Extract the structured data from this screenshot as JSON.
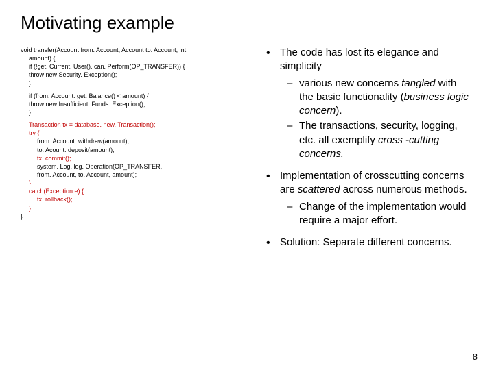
{
  "title": "Motivating example",
  "code": {
    "l1": "void transfer(Account from. Account, Account to. Account, int",
    "l2": "amount) {",
    "l3": "if (!get. Current. User(). can. Perform(OP_TRANSFER)) {",
    "l4": "throw new Security. Exception();",
    "l5": "}",
    "l6": "if (from. Account. get. Balance() < amount) {",
    "l7": "throw new Insufficient. Funds. Exception();",
    "l8": "}",
    "l9": "Transaction tx = database. new. Transaction();",
    "l10": "try {",
    "l11": "from. Account. withdraw(amount);",
    "l12": "to. Acount. deposit(amount);",
    "l13": "tx. commit();",
    "l14": "system. Log. log. Operation(OP_TRANSFER,",
    "l15": "from. Account, to. Account, amount);",
    "l16": "}",
    "l17": "catch(Exception e) {",
    "l18": "tx. rollback();",
    "l19": "}",
    "l20": "}"
  },
  "bullets": {
    "b1": "The code has lost its elegance and simplicity",
    "b1s1a": "various new concerns ",
    "b1s1b": "tangled",
    "b1s1c": " with the basic functionality (",
    "b1s1d": "business logic concern",
    "b1s1e": ").",
    "b1s2a": "The transactions, security, logging, etc. all exemplify ",
    "b1s2b": "cross -cutting concerns.",
    "b2a": "Implementation of crosscutting concerns are ",
    "b2b": "scattered",
    "b2c": " across numerous methods.",
    "b2s1": "Change of the implementation would require a major effort.",
    "b3": "Solution: Separate different concerns."
  },
  "pageNumber": "8"
}
